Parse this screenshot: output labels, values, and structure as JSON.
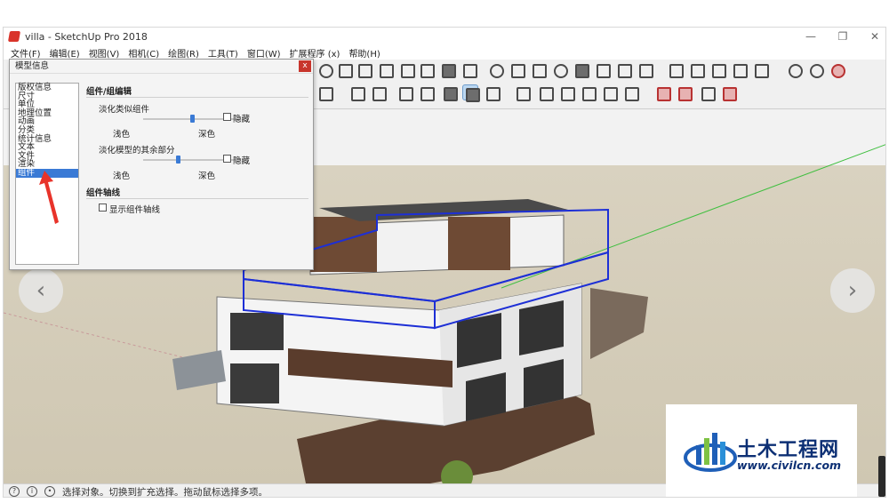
{
  "window": {
    "title": "villa - SketchUp Pro 2018",
    "minimize": "—",
    "maximize": "❐",
    "close": "✕"
  },
  "menu": {
    "items": [
      "文件(F)",
      "编辑(E)",
      "视图(V)",
      "相机(C)",
      "绘图(R)",
      "工具(T)",
      "窗口(W)",
      "扩展程序 (x)",
      "帮助(H)"
    ]
  },
  "dialog": {
    "title": "模型信息",
    "close": "x",
    "categories": [
      "版权信息",
      "尺寸",
      "单位",
      "地理位置",
      "动画",
      "分类",
      "统计信息",
      "文本",
      "文件",
      "渲染",
      "组件"
    ],
    "selected_index": 10,
    "section_edit": "组件/组编辑",
    "fade_similar_label": "淡化类似组件",
    "fade_similar_level": 0.5,
    "hide_label_1": "隐藏",
    "light_label_1": "浅色",
    "dark_label_1": "深色",
    "fade_rest_label": "淡化模型的其余部分",
    "fade_rest_level": 0.35,
    "hide_label_2": "隐藏",
    "light_label_2": "浅色",
    "dark_label_2": "深色",
    "section_axes": "组件轴线",
    "show_axes_label": "显示组件轴线"
  },
  "nav": {
    "prev": "‹",
    "next": "›"
  },
  "status": {
    "text": "选择对象。切换到扩充选择。拖动鼠标选择多项。"
  },
  "watermark": {
    "title": "土木工程网",
    "url": "www.civilcn.com"
  },
  "icons": {
    "status_icons": [
      "geolocation-icon",
      "info-icon",
      "user-icon"
    ]
  },
  "colors": {
    "selection_blue": "#3a7ad5",
    "accent_red": "#d9342b",
    "watermark_navy": "#0c2f74"
  }
}
